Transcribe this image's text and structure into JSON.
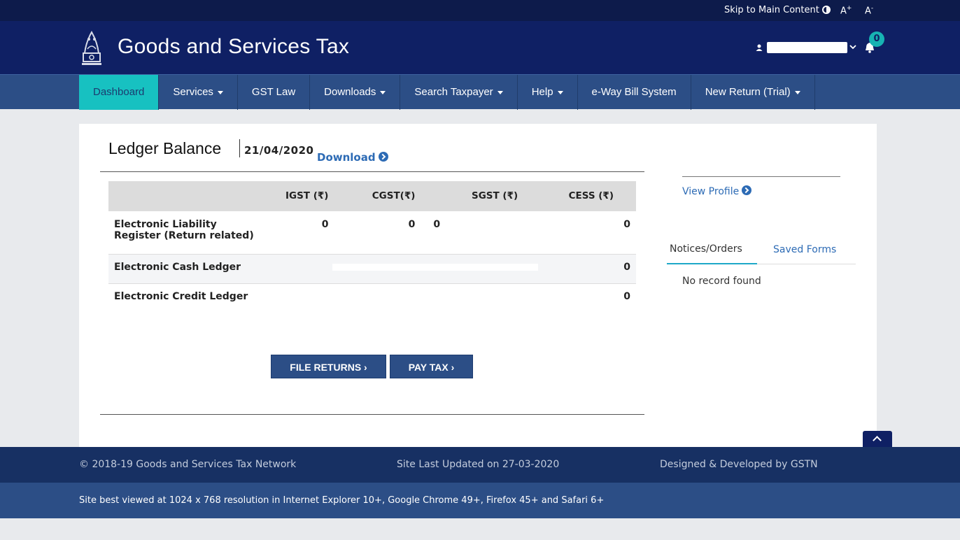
{
  "topbar": {
    "skip_label": "Skip to Main Content",
    "font_increase": "A",
    "font_increase_sign": "+",
    "font_decrease": "A",
    "font_decrease_sign": "-"
  },
  "header": {
    "title": "Goods and Services Tax",
    "notification_count": "0"
  },
  "nav": {
    "items": [
      {
        "label": "Dashboard"
      },
      {
        "label": "Services"
      },
      {
        "label": "GST Law"
      },
      {
        "label": "Downloads"
      },
      {
        "label": "Search Taxpayer"
      },
      {
        "label": "Help"
      },
      {
        "label": "e-Way Bill System"
      },
      {
        "label": "New Return (Trial)"
      }
    ]
  },
  "ledger": {
    "title": "Ledger Balance",
    "date": "21/04/2020",
    "download_label": "Download",
    "columns": [
      "IGST (₹)",
      "CGST(₹)",
      "SGST (₹)",
      "CESS (₹)"
    ],
    "rows": [
      {
        "label_line1": "Electronic Liability",
        "label_line2": "Register (Return related)",
        "igst": "0",
        "cgst": "0",
        "sgst": "0",
        "cess": "0"
      },
      {
        "label": "Electronic Cash Ledger",
        "cess": "0"
      },
      {
        "label": "Electronic Credit Ledger",
        "cess": "0"
      }
    ],
    "file_returns_label": "FILE RETURNS ›",
    "pay_tax_label": "PAY TAX ›"
  },
  "sidebar": {
    "view_profile_label": "View Profile",
    "tabs": [
      {
        "label": "Notices/Orders"
      },
      {
        "label": "Saved Forms"
      }
    ],
    "empty_message": "No record found"
  },
  "footer": {
    "copyright": "© 2018-19 Goods and Services Tax Network",
    "last_updated": "Site Last Updated on 27-03-2020",
    "developer": "Designed & Developed by GSTN",
    "browser_note": "Site best viewed at 1024 x 768 resolution in Internet Explorer 10+, Google Chrome 49+, Firefox 45+ and Safari 6+"
  },
  "colors": {
    "topbar_bg": "#0d1b4b",
    "header_bg": "#0f2064",
    "nav_bg": "#2c4e86",
    "nav_active_bg": "#17c1c1",
    "link_blue": "#2d6bb5",
    "badge_teal": "#17b3b3"
  },
  "icons": [
    "contrast-icon",
    "emblem-icon",
    "user-icon",
    "chevron-down-icon",
    "bell-icon",
    "arrow-circle-right-icon",
    "chevron-up-icon"
  ]
}
